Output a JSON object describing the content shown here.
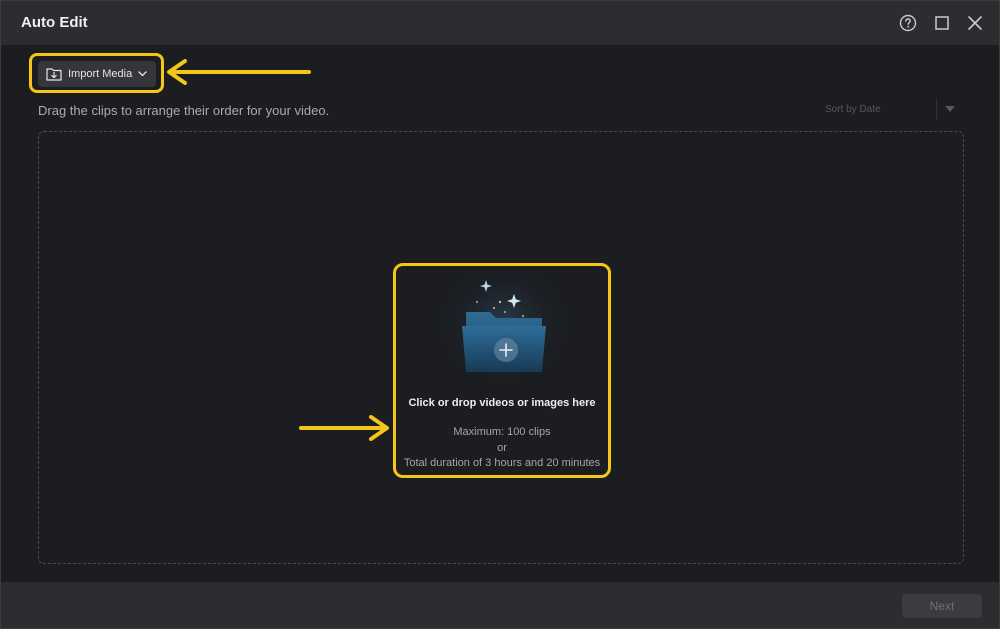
{
  "window": {
    "title": "Auto Edit"
  },
  "titlebar_icons": {
    "help": "help-circle-icon",
    "maximize": "maximize-icon",
    "close": "close-icon"
  },
  "toolbar": {
    "import_label": "Import Media"
  },
  "hint": "Drag the clips to arrange their order for your video.",
  "sort": {
    "label": "Sort by Date"
  },
  "dropzone": {
    "title": "Click or drop videos or images here",
    "max_clips": "Maximum: 100 clips",
    "or": "or",
    "max_duration": "Total duration of 3 hours and 20 minutes"
  },
  "footer": {
    "next_label": "Next"
  },
  "colors": {
    "highlight": "#f5c518",
    "background": "#1b1d21",
    "titlebar": "#2b2d31"
  }
}
